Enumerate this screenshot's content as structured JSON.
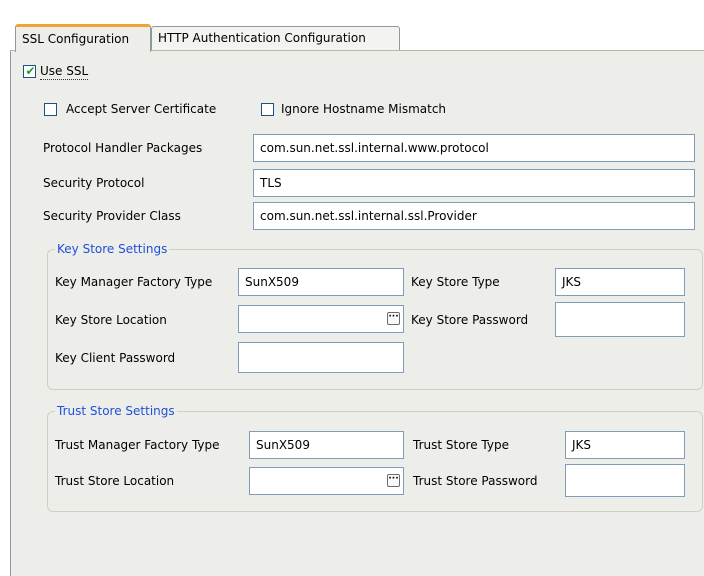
{
  "tabs": [
    {
      "label": "SSL Configuration",
      "active": true
    },
    {
      "label": "HTTP Authentication Configuration",
      "active": false
    }
  ],
  "use_ssl": {
    "label": "Use SSL",
    "checked": true
  },
  "accept_cert": {
    "label": "Accept Server Certificate",
    "checked": false
  },
  "ignore_hostname": {
    "label": "Ignore Hostname Mismatch",
    "checked": false
  },
  "protocol_handler": {
    "label": "Protocol Handler Packages",
    "value": "com.sun.net.ssl.internal.www.protocol"
  },
  "security_protocol": {
    "label": "Security Protocol",
    "value": "TLS"
  },
  "security_provider": {
    "label": "Security Provider Class",
    "value": "com.sun.net.ssl.internal.ssl.Provider"
  },
  "key_store": {
    "title": "Key Store Settings",
    "manager_factory_label": "Key Manager Factory Type",
    "manager_factory_value": "SunX509",
    "type_label": "Key Store Type",
    "type_value": "JKS",
    "location_label": "Key Store Location",
    "location_value": "",
    "password_label": "Key Store Password",
    "password_value": "",
    "client_password_label": "Key Client Password",
    "client_password_value": ""
  },
  "trust_store": {
    "title": "Trust Store Settings",
    "manager_factory_label": "Trust Manager Factory Type",
    "manager_factory_value": "SunX509",
    "type_label": "Trust Store Type",
    "type_value": "JKS",
    "location_label": "Trust Store Location",
    "location_value": "",
    "password_label": "Trust Store Password",
    "password_value": ""
  },
  "colors": {
    "accent": "#f0a335",
    "group_title": "#1f4fdb",
    "panel_bg": "#edeeea",
    "check": "#21a121"
  },
  "icons": {
    "browse": "ellipsis-icon",
    "check": "check-icon"
  }
}
